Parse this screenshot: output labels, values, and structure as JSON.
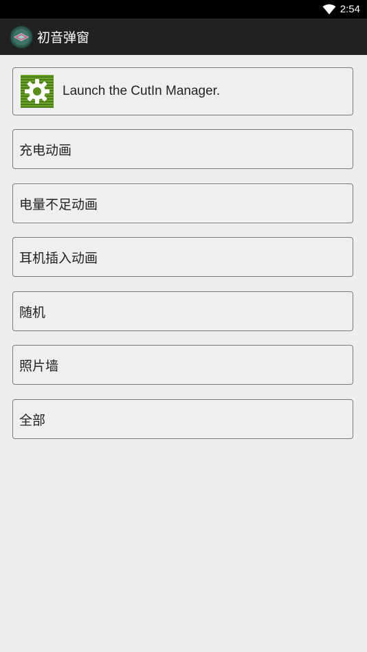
{
  "status_bar": {
    "time": "2:54",
    "wifi_icon": "wifi-icon"
  },
  "app_bar": {
    "title": "初音弹窗",
    "icon": "app-logo-icon"
  },
  "launch_card": {
    "label": "Launch the CutIn Manager.",
    "icon": "gear-icon"
  },
  "menu": {
    "items": [
      {
        "label": "充电动画"
      },
      {
        "label": "电量不足动画"
      },
      {
        "label": "耳机插入动画"
      },
      {
        "label": "随机"
      },
      {
        "label": "照片墙"
      },
      {
        "label": "全部"
      }
    ]
  },
  "colors": {
    "status_bar_bg": "#000000",
    "app_bar_bg": "#212121",
    "page_bg": "#eeeeee",
    "gear_bg": "#5a8f1e"
  }
}
